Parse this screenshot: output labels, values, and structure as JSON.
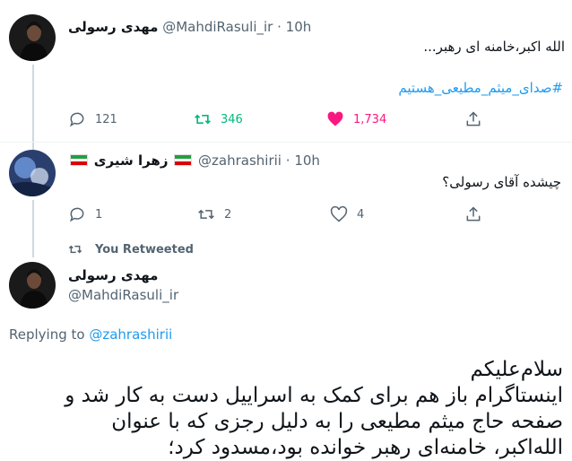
{
  "tweet1": {
    "name": "مهدی رسولی",
    "handle": "@MahdiRasuli_ir",
    "separator": "·",
    "time": "10h",
    "text": "الله اکبر،خامنه ای رهبر...",
    "hashtag": "#صدای_میثم_مطیعی_هستیم",
    "actions": {
      "reply_icon": "reply-icon",
      "reply_count": "121",
      "retweet_icon": "retweet-icon",
      "retweet_count": "346",
      "retweet_active": true,
      "like_icon": "heart-icon",
      "like_count": "1,734",
      "like_active": true,
      "share_icon": "share-icon"
    }
  },
  "tweet2": {
    "name": "زهرا شیری",
    "handle": "@zahrashirii",
    "separator": "·",
    "time": "10h",
    "text": "چیشده آقای رسولی؟",
    "actions": {
      "reply_count": "1",
      "retweet_count": "2",
      "like_count": "4"
    }
  },
  "retweet_banner": {
    "label": "You Retweeted"
  },
  "main_tweet": {
    "name": "مهدی رسولی",
    "handle": "@MahdiRasuli_ir",
    "replying_prefix": "Replying to",
    "replying_to": "@zahrashirii",
    "lines": [
      "سلام‌علیکم",
      "اینستاگرام باز هم برای کمک به اسراییل دست به کار شد و",
      "صفحه حاج میثم مطیعی را به دلیل رجزی که با عنوان",
      "الله‌اکبر، خامنه‌ای رهبر خوانده بود،مسدود کرد؛"
    ]
  },
  "colors": {
    "accent": "#1d9bf0",
    "retweet_green": "#00ba7c",
    "like_pink": "#f91880",
    "muted": "#536471"
  }
}
